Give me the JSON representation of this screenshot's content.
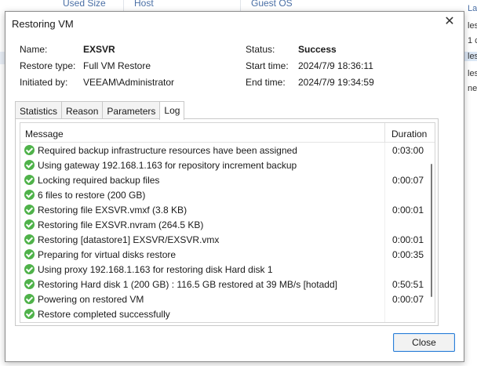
{
  "background": {
    "columns": [
      "Used Size",
      "Host",
      "Guest OS"
    ],
    "right_items": [
      "La",
      "les",
      "1 c",
      "les",
      "les",
      "ne"
    ]
  },
  "dialog": {
    "title": "Restoring VM",
    "close_icon": "close-icon",
    "info": {
      "name_label": "Name:",
      "name_value": "EXSVR",
      "restore_type_label": "Restore type:",
      "restore_type_value": "Full VM Restore",
      "initiated_by_label": "Initiated by:",
      "initiated_by_value": "VEEAM\\Administrator",
      "status_label": "Status:",
      "status_value": "Success",
      "start_time_label": "Start time:",
      "start_time_value": "2024/7/9 18:36:11",
      "end_time_label": "End time:",
      "end_time_value": "2024/7/9 19:34:59"
    },
    "tabs": [
      "Statistics",
      "Reason",
      "Parameters",
      "Log"
    ],
    "active_tab": "Log",
    "log": {
      "headers": {
        "message": "Message",
        "duration": "Duration"
      },
      "rows": [
        {
          "message": "Required backup infrastructure resources have been assigned",
          "duration": "0:03:00"
        },
        {
          "message": "Using gateway 192.168.1.163 for repository increment backup",
          "duration": ""
        },
        {
          "message": "Locking required backup files",
          "duration": "0:00:07"
        },
        {
          "message": "6 files to restore (200 GB)",
          "duration": ""
        },
        {
          "message": "Restoring file EXSVR.vmxf (3.8 KB)",
          "duration": "0:00:01"
        },
        {
          "message": "Restoring file EXSVR.nvram (264.5 KB)",
          "duration": ""
        },
        {
          "message": "Restoring [datastore1] EXSVR/EXSVR.vmx",
          "duration": "0:00:01"
        },
        {
          "message": "Preparing for virtual disks restore",
          "duration": "0:00:35"
        },
        {
          "message": "Using proxy 192.168.1.163 for restoring disk Hard disk 1",
          "duration": ""
        },
        {
          "message": "Restoring Hard disk 1 (200 GB) : 116.5 GB restored at 39 MB/s  [hotadd]",
          "duration": "0:50:51"
        },
        {
          "message": "Powering on restored VM",
          "duration": "0:00:07"
        },
        {
          "message": "Restore completed successfully",
          "duration": ""
        }
      ],
      "status_icon": "success-check-icon",
      "status_color": "#4fb24a"
    },
    "close_button": "Close"
  }
}
